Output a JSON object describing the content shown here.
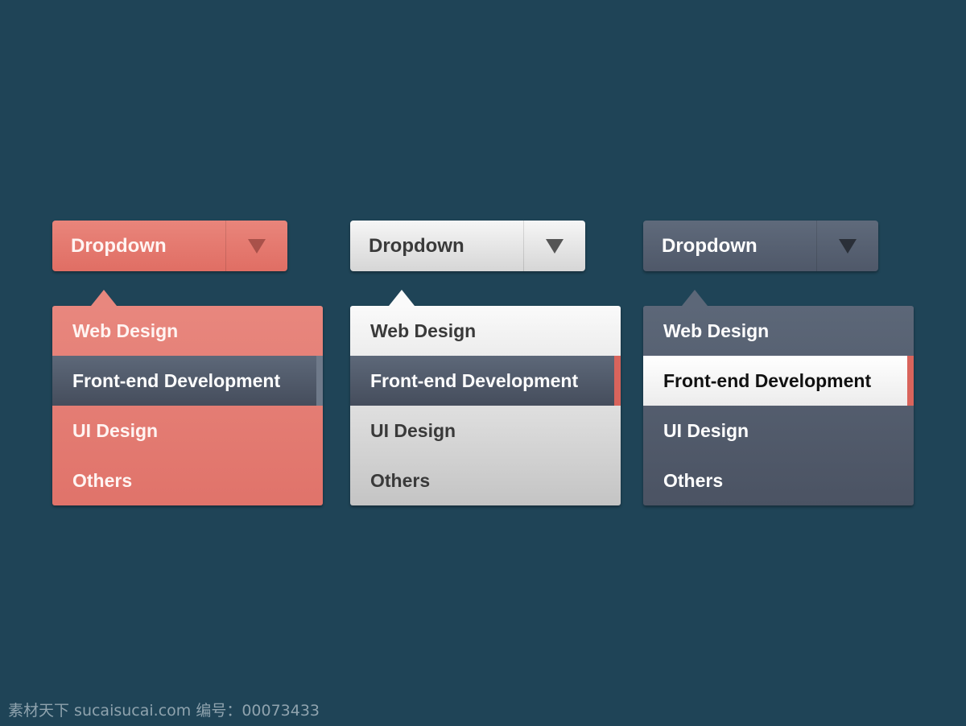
{
  "dropdowns": [
    {
      "theme": "coral",
      "button_label": "Dropdown",
      "caret_icon": "triangle-down-icon",
      "items": [
        "Web Design",
        "Front-end Development",
        "UI Design",
        "Others"
      ],
      "selected": "Front-end Development",
      "colors": {
        "base": "#e3786e",
        "selected": "#535d6d"
      }
    },
    {
      "theme": "light",
      "button_label": "Dropdown",
      "caret_icon": "triangle-down-icon",
      "items": [
        "Web Design",
        "Front-end Development",
        "UI Design",
        "Others"
      ],
      "selected": "Front-end Development",
      "colors": {
        "base": "#e8e8e8",
        "selected": "#535d6d",
        "accent": "#d9645c"
      }
    },
    {
      "theme": "slate",
      "button_label": "Dropdown",
      "caret_icon": "triangle-down-icon",
      "items": [
        "Web Design",
        "Front-end Development",
        "UI Design",
        "Others"
      ],
      "selected": "Front-end Development",
      "colors": {
        "base": "#566172",
        "selected": "#ffffff",
        "accent": "#d9645c"
      }
    }
  ],
  "background": "#1f4457",
  "watermark": "素材天下 sucaisucai.com  编号：00073433"
}
